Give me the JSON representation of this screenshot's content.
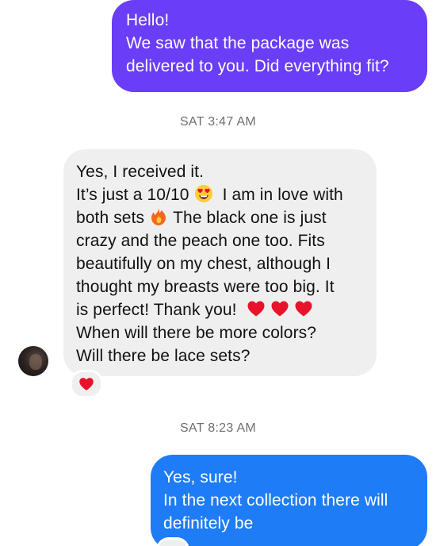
{
  "messages": [
    {
      "id": "out-1",
      "direction": "outgoing",
      "color": "#6a3df6",
      "lines": [
        "Hello!",
        "We saw that the package was",
        "delivered to you. Did everything fit?"
      ]
    },
    {
      "id": "in-1",
      "direction": "incoming",
      "color": "#efefef",
      "text_segments": {
        "l1": "Yes, I received it.",
        "l2a": "It’s just a 10/10",
        "l2b": "I am in love with",
        "l3a": "both sets",
        "l3b": "The black one is just",
        "l4": "crazy and the peach one too. Fits",
        "l5": "beautifully on my chest, although I",
        "l6": "thought my breasts were too big. It",
        "l7a": "is perfect! Thank you!",
        "l8": "When will there be more colors?",
        "l9": "Will there be lace sets?"
      },
      "emojis": [
        "heart-eyes-emoji",
        "fire-emoji",
        "heart-emoji",
        "heart-emoji",
        "heart-emoji"
      ],
      "reaction": "heart-emoji"
    },
    {
      "id": "out-2",
      "direction": "outgoing",
      "color": "#1f7cf7",
      "lines": [
        "Yes, sure!",
        "In the next collection there will",
        "definitely be"
      ]
    }
  ],
  "timestamps": {
    "first": "SAT 3:47 AM",
    "second": "SAT 8:23 AM"
  },
  "colors": {
    "outgoing_purple": "#6a3df6",
    "outgoing_blue": "#1f7cf7",
    "incoming_grey": "#efefef",
    "heart_red": "#e8132b"
  }
}
